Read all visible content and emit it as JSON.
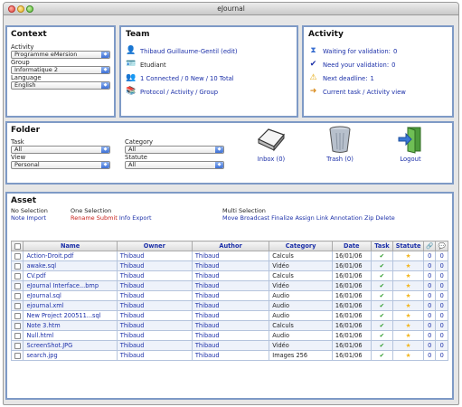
{
  "window": {
    "title": "eJournal"
  },
  "context": {
    "heading": "Context",
    "activity_label": "Activity",
    "activity_value": "Programme eMersion",
    "group_label": "Group",
    "group_value": "Informatique 2",
    "language_label": "Language",
    "language_value": "English"
  },
  "team": {
    "heading": "Team",
    "user": "Thibaud Guillaume-Gentil (edit)",
    "role": "Etudiant",
    "stats": {
      "connected": "1 Connected",
      "new": "0 New",
      "total": "10 Total",
      "sep": "/"
    },
    "links": {
      "protocol": "Protocol",
      "activity": "Activity",
      "group": "Group",
      "sep": "/"
    }
  },
  "activity": {
    "heading": "Activity",
    "waiting": "Waiting for validation:",
    "waiting_count": "0",
    "need": "Need your validation:",
    "need_count": "0",
    "deadline": "Next deadline:",
    "deadline_count": "1",
    "current": "Current task / Activity view"
  },
  "folder": {
    "heading": "Folder",
    "task_label": "Task",
    "task_value": "All",
    "category_label": "Category",
    "category_value": "All",
    "view_label": "View",
    "view_value": "Personal",
    "statute_label": "Statute",
    "statute_value": "All",
    "inbox": "Inbox (0)",
    "trash": "Trash (0)",
    "logout": "Logout"
  },
  "asset": {
    "heading": "Asset",
    "no_selection": "No Selection",
    "no_sel_actions": [
      "Note",
      "Import"
    ],
    "one_selection": "One Selection",
    "one_sel_actions": [
      "Rename",
      "Submit",
      "Info",
      "Export"
    ],
    "multi_selection": "Multi Selection",
    "multi_sel_actions": [
      "Move",
      "Broadcast",
      "Finalize",
      "Assign",
      "Link",
      "Annotation",
      "Zip",
      "Delete"
    ],
    "columns": [
      "Name",
      "Owner",
      "Author",
      "Category",
      "Date",
      "Task",
      "Statute"
    ],
    "rows": [
      {
        "name": "Action-Droit.pdf",
        "owner": "Thibaud",
        "author": "Thibaud",
        "category": "Calculs",
        "date": "16/01/06",
        "c1": "0",
        "c2": "0"
      },
      {
        "name": "awake.sql",
        "owner": "Thibaud",
        "author": "Thibaud",
        "category": "Vidéo",
        "date": "16/01/06",
        "c1": "0",
        "c2": "0"
      },
      {
        "name": "CV.pdf",
        "owner": "Thibaud",
        "author": "Thibaud",
        "category": "Calculs",
        "date": "16/01/06",
        "c1": "0",
        "c2": "0"
      },
      {
        "name": "eJournal Interface...bmp",
        "owner": "Thibaud",
        "author": "Thibaud",
        "category": "Vidéo",
        "date": "16/01/06",
        "c1": "0",
        "c2": "0"
      },
      {
        "name": "eJournal.sql",
        "owner": "Thibaud",
        "author": "Thibaud",
        "category": "Audio",
        "date": "16/01/06",
        "c1": "0",
        "c2": "0"
      },
      {
        "name": "ejournal.xml",
        "owner": "Thibaud",
        "author": "Thibaud",
        "category": "Audio",
        "date": "16/01/06",
        "c1": "0",
        "c2": "0"
      },
      {
        "name": "New Project 200511...sql",
        "owner": "Thibaud",
        "author": "Thibaud",
        "category": "Audio",
        "date": "16/01/06",
        "c1": "0",
        "c2": "0"
      },
      {
        "name": "Note 3.htm",
        "owner": "Thibaud",
        "author": "Thibaud",
        "category": "Calculs",
        "date": "16/01/06",
        "c1": "0",
        "c2": "0"
      },
      {
        "name": "Null.html",
        "owner": "Thibaud",
        "author": "Thibaud",
        "category": "Audio",
        "date": "16/01/06",
        "c1": "0",
        "c2": "0"
      },
      {
        "name": "ScreenShot.JPG",
        "owner": "Thibaud",
        "author": "Thibaud",
        "category": "Vidéo",
        "date": "16/01/06",
        "c1": "0",
        "c2": "0"
      },
      {
        "name": "search.jpg",
        "owner": "Thibaud",
        "author": "Thibaud",
        "category": "Images 256",
        "date": "16/01/06",
        "c1": "0",
        "c2": "0"
      }
    ]
  },
  "colors": {
    "panel_border": "#7e9ac6",
    "link": "#1b2fa8",
    "red_action": "#c7201b"
  }
}
